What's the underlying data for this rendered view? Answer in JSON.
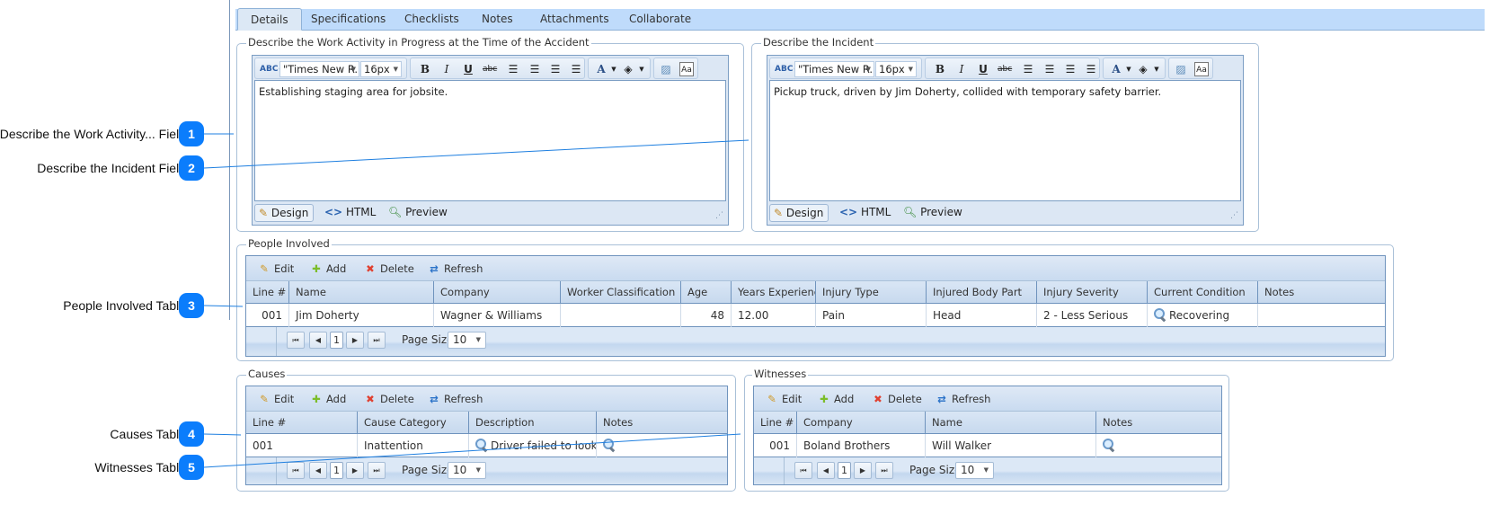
{
  "tabs": [
    {
      "label": "Details",
      "active": true
    },
    {
      "label": "Specifications",
      "active": false
    },
    {
      "label": "Checklists",
      "active": false
    },
    {
      "label": "Notes",
      "active": false
    },
    {
      "label": "Attachments",
      "active": false
    },
    {
      "label": "Collaborate",
      "active": false
    }
  ],
  "editors": {
    "work_activity": {
      "legend": "Describe the Work Activity in Progress at the Time of the Accident",
      "font": "\"Times New R...",
      "size": "16px",
      "content": "Establishing staging area for jobsite."
    },
    "incident": {
      "legend": "Describe the Incident",
      "font": "\"Times New R...",
      "size": "16px",
      "content": "Pickup truck, driven by Jim Doherty, collided with temporary safety barrier."
    },
    "modes": {
      "design": "Design",
      "html": "HTML",
      "preview": "Preview"
    }
  },
  "grid_toolbar": {
    "edit": "Edit",
    "add": "Add",
    "delete": "Delete",
    "refresh": "Refresh"
  },
  "pager": {
    "current_page": "1",
    "page_size_label": "Page Size",
    "page_size": "10"
  },
  "people": {
    "legend": "People Involved",
    "columns": [
      "Line #",
      "Name",
      "Company",
      "Worker Classification",
      "Age",
      "Years Experience",
      "Injury Type",
      "Injured Body Part",
      "Injury Severity",
      "Current Condition",
      "Notes"
    ],
    "rows": [
      [
        "001",
        "Jim Doherty",
        "Wagner & Williams",
        "",
        "48",
        "12.00",
        "Pain",
        "Head",
        "2 - Less Serious",
        "Recovering",
        ""
      ]
    ]
  },
  "causes": {
    "legend": "Causes",
    "columns": [
      "Line #",
      "Cause Category",
      "Description",
      "Notes"
    ],
    "rows": [
      [
        "001",
        "Inattention",
        "Driver failed to look bel",
        ""
      ]
    ]
  },
  "witnesses": {
    "legend": "Witnesses",
    "columns": [
      "Line #",
      "Company",
      "Name",
      "Notes"
    ],
    "rows": [
      [
        "001",
        "Boland Brothers",
        "Will Walker",
        ""
      ]
    ]
  },
  "callouts": [
    {
      "number": "1",
      "label": "Describe the Work Activity... Field"
    },
    {
      "number": "2",
      "label": "Describe the Incident Field"
    },
    {
      "number": "3",
      "label": "People Involved Table"
    },
    {
      "number": "4",
      "label": "Causes Table"
    },
    {
      "number": "5",
      "label": "Witnesses Table"
    }
  ],
  "colors": {
    "accent": "#0b7dfc",
    "tabbar": "#bfdbfb",
    "grid_border": "#6f93bd"
  }
}
